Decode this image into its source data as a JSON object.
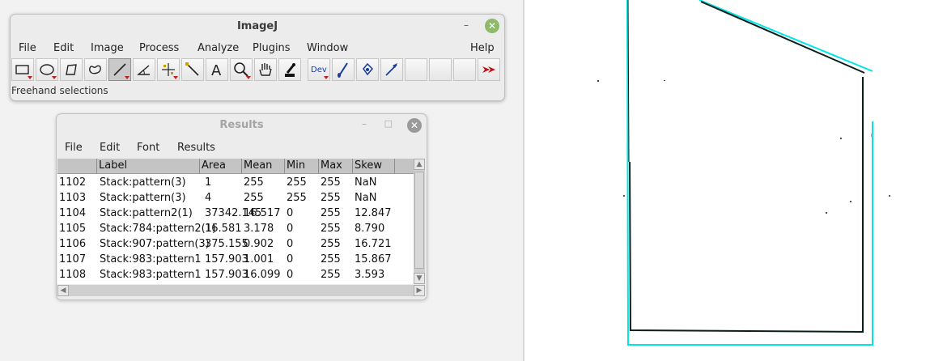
{
  "imagej": {
    "title": "ImageJ",
    "min_glyph": "–",
    "close_glyph": "✕",
    "menu": [
      "File",
      "Edit",
      "Image",
      "Process",
      "Analyze",
      "Plugins",
      "Window",
      "Help"
    ],
    "tools": [
      {
        "icon": "rectangle-icon"
      },
      {
        "icon": "oval-icon"
      },
      {
        "icon": "polygon-icon"
      },
      {
        "icon": "freehand-icon"
      },
      {
        "icon": "line-icon",
        "selected": true
      },
      {
        "icon": "angle-icon"
      },
      {
        "icon": "point-icon"
      },
      {
        "icon": "wand-icon"
      },
      {
        "icon": "text-icon",
        "label": "A"
      },
      {
        "icon": "magnifier-icon"
      },
      {
        "icon": "hand-icon"
      },
      {
        "icon": "color-picker-icon"
      },
      {
        "icon": "dev-menu-icon",
        "label": "Dev"
      },
      {
        "icon": "brush-icon"
      },
      {
        "icon": "flood-fill-icon"
      },
      {
        "icon": "arrow-icon"
      },
      {
        "icon": "empty-slot-icon"
      },
      {
        "icon": "empty-slot-icon"
      },
      {
        "icon": "empty-slot-icon"
      },
      {
        "icon": "more-tools-icon"
      }
    ],
    "status": "Freehand selections"
  },
  "results": {
    "title": "Results",
    "min_glyph": "–",
    "max_glyph": "□",
    "close_glyph": "✕",
    "menu": [
      "File",
      "Edit",
      "Font",
      "Results"
    ],
    "columns": [
      "",
      "Label",
      "Area",
      "Mean",
      "Min",
      "Max",
      "Skew"
    ],
    "rows": [
      [
        "1102",
        "Stack:pattern(3)",
        "1",
        "255",
        "255",
        "255",
        "NaN"
      ],
      [
        "1103",
        "Stack:pattern(3)",
        "4",
        "255",
        "255",
        "255",
        "NaN"
      ],
      [
        "1104",
        "Stack:pattern2(1)",
        "37342.145",
        "16.517",
        "0",
        "255",
        "12.847"
      ],
      [
        "1105",
        "Stack:784:pattern2(1)",
        "16.581",
        "3.178",
        "0",
        "255",
        "8.790"
      ],
      [
        "1106",
        "Stack:907:pattern(3)",
        "375.155",
        "0.902",
        "0",
        "255",
        "16.721"
      ],
      [
        "1107",
        "Stack:983:pattern1",
        "157.903",
        "1.001",
        "0",
        "255",
        "15.867"
      ],
      [
        "1108",
        "Stack:983:pattern1",
        "157.903",
        "16.099",
        "0",
        "255",
        "3.593"
      ]
    ]
  },
  "colors": {
    "accent_cyan": "#00e5e5",
    "outline_dark": "#0a1e1e",
    "close_green": "#8dbb6b",
    "arrow_red": "#c01010"
  }
}
